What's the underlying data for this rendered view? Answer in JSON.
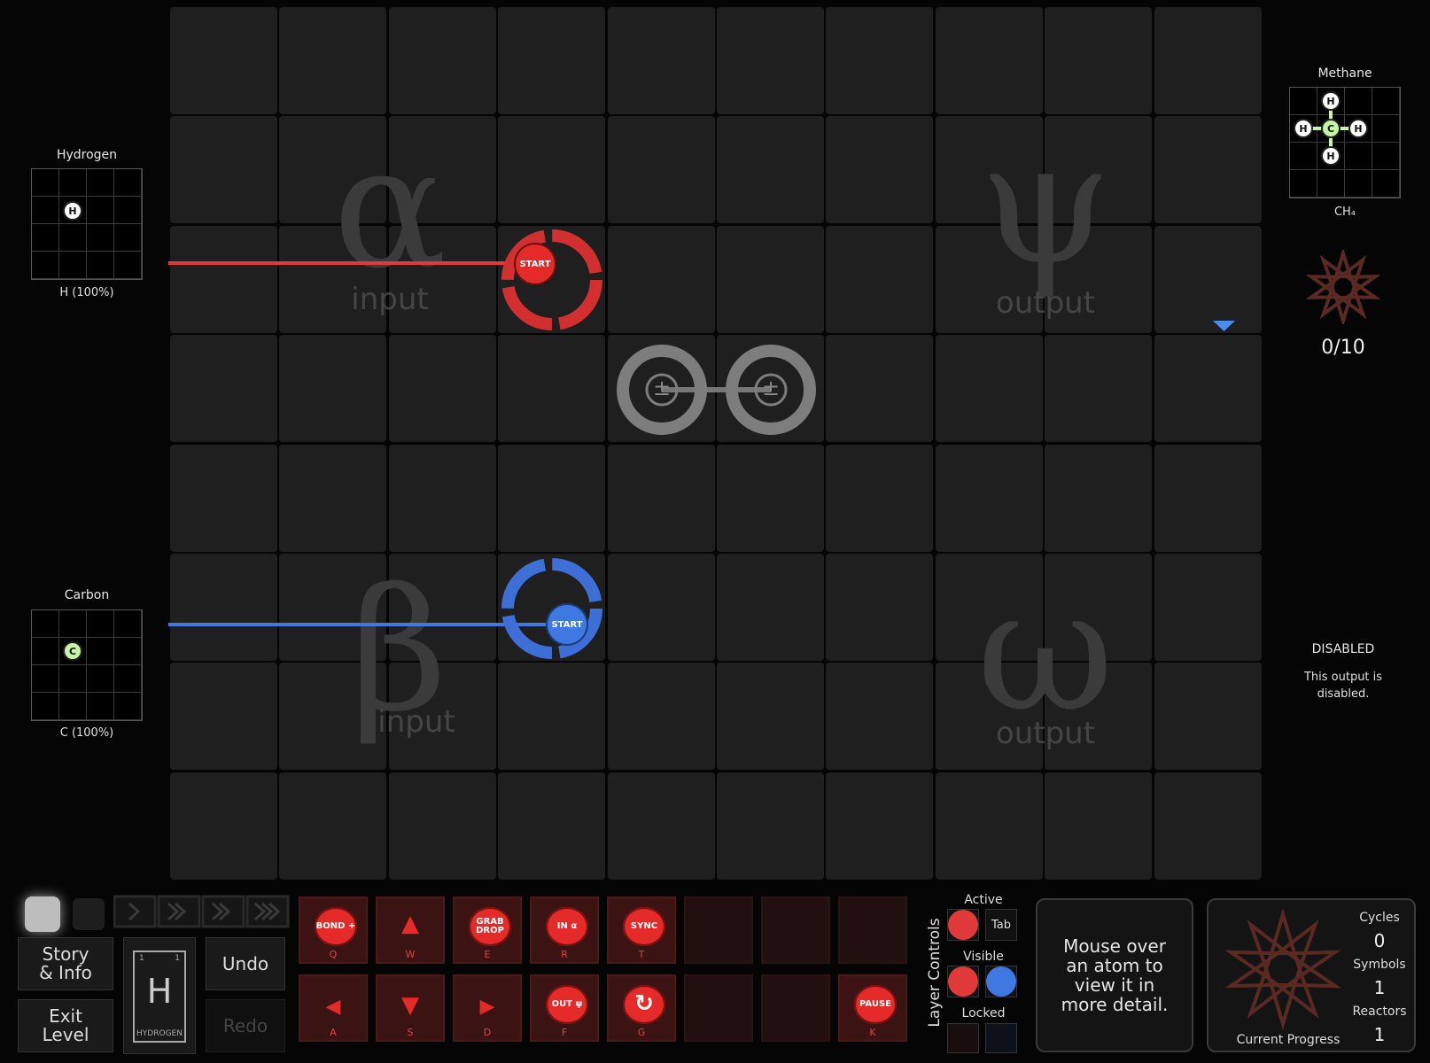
{
  "board": {
    "regions": [
      {
        "glyph": "α",
        "word": "input"
      },
      {
        "glyph": "β",
        "word": "input"
      },
      {
        "glyph": "ψ",
        "word": "output"
      },
      {
        "glyph": "ω",
        "word": "output"
      }
    ],
    "waldo_red_label": "START",
    "waldo_blue_label": "START",
    "bonder_glyph": "±"
  },
  "inputs": {
    "hydrogen": {
      "title": "Hydrogen",
      "atom": "H",
      "footer": "H (100%)"
    },
    "carbon": {
      "title": "Carbon",
      "atom": "C",
      "footer": "C (100%)"
    }
  },
  "outputs": {
    "methane": {
      "title": "Methane",
      "formula": "CH₄",
      "center_atom": "C",
      "outer_atom": "H",
      "progress": "0/10"
    },
    "disabled": {
      "title": "DISABLED",
      "text": "This output is disabled."
    }
  },
  "toolbar": {
    "story_info": "Story & Info",
    "exit_level": "Exit Level",
    "undo": "Undo",
    "redo": "Redo",
    "element_symbol": "H",
    "element_name": "HYDROGEN",
    "element_num_left": "1",
    "element_num_right": "1",
    "tools": [
      {
        "label": "BOND +",
        "key": "Q"
      },
      {
        "label": "▲",
        "key": "W"
      },
      {
        "label": "GRAB DROP",
        "key": "E"
      },
      {
        "label": "IN α",
        "key": "R"
      },
      {
        "label": "SYNC",
        "key": "T"
      },
      {
        "label": "◀",
        "key": "A"
      },
      {
        "label": "▼",
        "key": "S"
      },
      {
        "label": "▶",
        "key": "D"
      },
      {
        "label": "OUT ψ",
        "key": "F"
      },
      {
        "label": "↻",
        "key": "G"
      },
      {
        "label": "PAUSE",
        "key": "K"
      }
    ]
  },
  "layer_controls": {
    "title": "Layer Controls",
    "active": "Active",
    "tab": "Tab",
    "visible": "Visible",
    "locked": "Locked",
    "red": "#e03a3a",
    "blue": "#3f78e0"
  },
  "info_panel": {
    "text": "Mouse over an atom to view it in more detail."
  },
  "stats": {
    "cycles_label": "Cycles",
    "cycles": "0",
    "symbols_label": "Symbols",
    "symbols": "1",
    "reactors_label": "Reactors",
    "reactors": "1",
    "progress_label": "Current Progress"
  }
}
